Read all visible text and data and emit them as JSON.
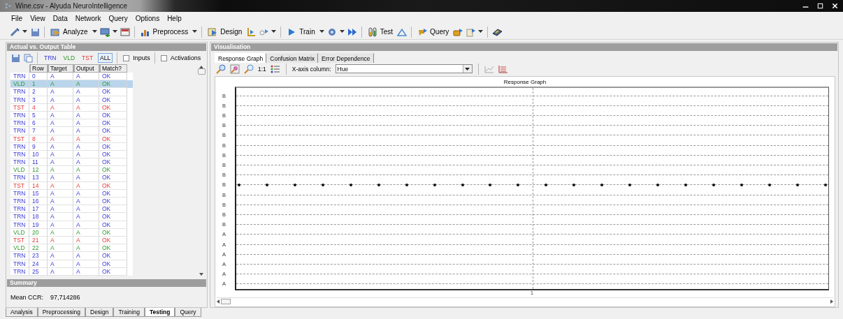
{
  "window": {
    "title": "Wine.csv - Alyuda NeuroIntelligence"
  },
  "menu": [
    {
      "label": "File"
    },
    {
      "label": "View"
    },
    {
      "label": "Data"
    },
    {
      "label": "Network"
    },
    {
      "label": "Query"
    },
    {
      "label": "Options"
    },
    {
      "label": "Help"
    }
  ],
  "toolbar": [
    {
      "label": "Analyze"
    },
    {
      "label": "Preprocess"
    },
    {
      "label": "Design"
    },
    {
      "label": "Train"
    },
    {
      "label": "Test"
    },
    {
      "label": "Query"
    }
  ],
  "left_panel": {
    "title": "Actual vs. Output Table",
    "filters": [
      {
        "label": "TRN",
        "kind": "trn",
        "selected": false
      },
      {
        "label": "VLD",
        "kind": "vld",
        "selected": false
      },
      {
        "label": "TST",
        "kind": "tst",
        "selected": false
      },
      {
        "label": "ALL",
        "kind": "all",
        "selected": true
      }
    ],
    "checkboxes": [
      {
        "label": "Inputs",
        "checked": false
      },
      {
        "label": "Activations",
        "checked": false
      }
    ],
    "table": {
      "columns": [
        "Row",
        "Target",
        "Output",
        "Match?"
      ],
      "rows": [
        {
          "set": "TRN",
          "row": "0",
          "target": "A",
          "output": "A",
          "match": "OK",
          "kind": "trn",
          "selected": false
        },
        {
          "set": "VLD",
          "row": "1",
          "target": "A",
          "output": "A",
          "match": "OK",
          "kind": "vld",
          "selected": true
        },
        {
          "set": "TRN",
          "row": "2",
          "target": "A",
          "output": "A",
          "match": "OK",
          "kind": "trn",
          "selected": false
        },
        {
          "set": "TRN",
          "row": "3",
          "target": "A",
          "output": "A",
          "match": "OK",
          "kind": "trn",
          "selected": false
        },
        {
          "set": "TST",
          "row": "4",
          "target": "A",
          "output": "A",
          "match": "OK",
          "kind": "tst",
          "selected": false
        },
        {
          "set": "TRN",
          "row": "5",
          "target": "A",
          "output": "A",
          "match": "OK",
          "kind": "trn",
          "selected": false
        },
        {
          "set": "TRN",
          "row": "6",
          "target": "A",
          "output": "A",
          "match": "OK",
          "kind": "trn",
          "selected": false
        },
        {
          "set": "TRN",
          "row": "7",
          "target": "A",
          "output": "A",
          "match": "OK",
          "kind": "trn",
          "selected": false
        },
        {
          "set": "TST",
          "row": "8",
          "target": "A",
          "output": "A",
          "match": "OK",
          "kind": "tst",
          "selected": false
        },
        {
          "set": "TRN",
          "row": "9",
          "target": "A",
          "output": "A",
          "match": "OK",
          "kind": "trn",
          "selected": false
        },
        {
          "set": "TRN",
          "row": "10",
          "target": "A",
          "output": "A",
          "match": "OK",
          "kind": "trn",
          "selected": false
        },
        {
          "set": "TRN",
          "row": "11",
          "target": "A",
          "output": "A",
          "match": "OK",
          "kind": "trn",
          "selected": false
        },
        {
          "set": "VLD",
          "row": "12",
          "target": "A",
          "output": "A",
          "match": "OK",
          "kind": "vld",
          "selected": false
        },
        {
          "set": "TRN",
          "row": "13",
          "target": "A",
          "output": "A",
          "match": "OK",
          "kind": "trn",
          "selected": false
        },
        {
          "set": "TST",
          "row": "14",
          "target": "A",
          "output": "A",
          "match": "OK",
          "kind": "tst",
          "selected": false
        },
        {
          "set": "TRN",
          "row": "15",
          "target": "A",
          "output": "A",
          "match": "OK",
          "kind": "trn",
          "selected": false
        },
        {
          "set": "TRN",
          "row": "16",
          "target": "A",
          "output": "A",
          "match": "OK",
          "kind": "trn",
          "selected": false
        },
        {
          "set": "TRN",
          "row": "17",
          "target": "A",
          "output": "A",
          "match": "OK",
          "kind": "trn",
          "selected": false
        },
        {
          "set": "TRN",
          "row": "18",
          "target": "A",
          "output": "A",
          "match": "OK",
          "kind": "trn",
          "selected": false
        },
        {
          "set": "TRN",
          "row": "19",
          "target": "A",
          "output": "A",
          "match": "OK",
          "kind": "trn",
          "selected": false
        },
        {
          "set": "VLD",
          "row": "20",
          "target": "A",
          "output": "A",
          "match": "OK",
          "kind": "vld",
          "selected": false
        },
        {
          "set": "TST",
          "row": "21",
          "target": "A",
          "output": "A",
          "match": "OK",
          "kind": "tst",
          "selected": false
        },
        {
          "set": "VLD",
          "row": "22",
          "target": "A",
          "output": "A",
          "match": "OK",
          "kind": "vld",
          "selected": false
        },
        {
          "set": "TRN",
          "row": "23",
          "target": "A",
          "output": "A",
          "match": "OK",
          "kind": "trn",
          "selected": false
        },
        {
          "set": "TRN",
          "row": "24",
          "target": "A",
          "output": "A",
          "match": "OK",
          "kind": "trn",
          "selected": false
        },
        {
          "set": "TRN",
          "row": "25",
          "target": "A",
          "output": "A",
          "match": "OK",
          "kind": "trn",
          "selected": false
        }
      ]
    },
    "summary": {
      "title": "Summary",
      "label": "Mean CCR:",
      "value": "97,714286"
    }
  },
  "right_panel": {
    "title": "Visualisation",
    "tabs": [
      {
        "label": "Response Graph",
        "selected": true
      },
      {
        "label": "Confusion Matrix",
        "selected": false
      },
      {
        "label": "Error Dependence",
        "selected": false
      }
    ],
    "zoom_label": "1:1",
    "x_axis": {
      "label": "X-axis column:",
      "value": "Hue"
    },
    "graph": {
      "title": "Response Graph",
      "x_tick": "1",
      "y_labels": [
        "B",
        "B",
        "B",
        "B",
        "B",
        "B",
        "B",
        "B",
        "B",
        "B",
        "B",
        "B",
        "B",
        "B",
        "A",
        "A",
        "A",
        "A",
        "A",
        "A"
      ]
    }
  },
  "bottom_tabs": [
    {
      "label": "Analysis",
      "selected": false
    },
    {
      "label": "Preprocessing",
      "selected": false
    },
    {
      "label": "Design",
      "selected": false
    },
    {
      "label": "Training",
      "selected": false
    },
    {
      "label": "Testing",
      "selected": true
    },
    {
      "label": "Query",
      "selected": false
    }
  ]
}
